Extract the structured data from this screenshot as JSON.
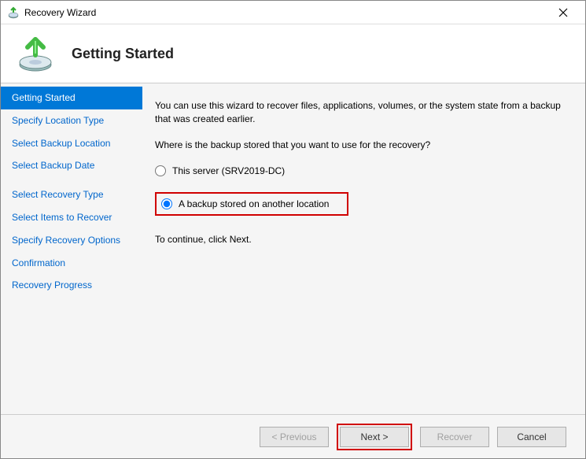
{
  "window": {
    "title": "Recovery Wizard"
  },
  "header": {
    "title": "Getting Started"
  },
  "sidebar": {
    "items": [
      {
        "label": "Getting Started",
        "active": true
      },
      {
        "label": "Specify Location Type",
        "active": false
      },
      {
        "label": "Select Backup Location",
        "active": false
      },
      {
        "label": "Select Backup Date",
        "active": false
      },
      {
        "label": "Select Recovery Type",
        "active": false
      },
      {
        "label": "Select Items to Recover",
        "active": false
      },
      {
        "label": "Specify Recovery Options",
        "active": false
      },
      {
        "label": "Confirmation",
        "active": false
      },
      {
        "label": "Recovery Progress",
        "active": false
      }
    ]
  },
  "content": {
    "intro": "You can use this wizard to recover files, applications, volumes, or the system state from a backup that was created earlier.",
    "question": "Where is the backup stored that you want to use for the recovery?",
    "option1": "This server (SRV2019-DC)",
    "option2": "A backup stored on another location",
    "continue": "To continue, click Next."
  },
  "footer": {
    "previous": "< Previous",
    "next": "Next >",
    "recover": "Recover",
    "cancel": "Cancel"
  }
}
